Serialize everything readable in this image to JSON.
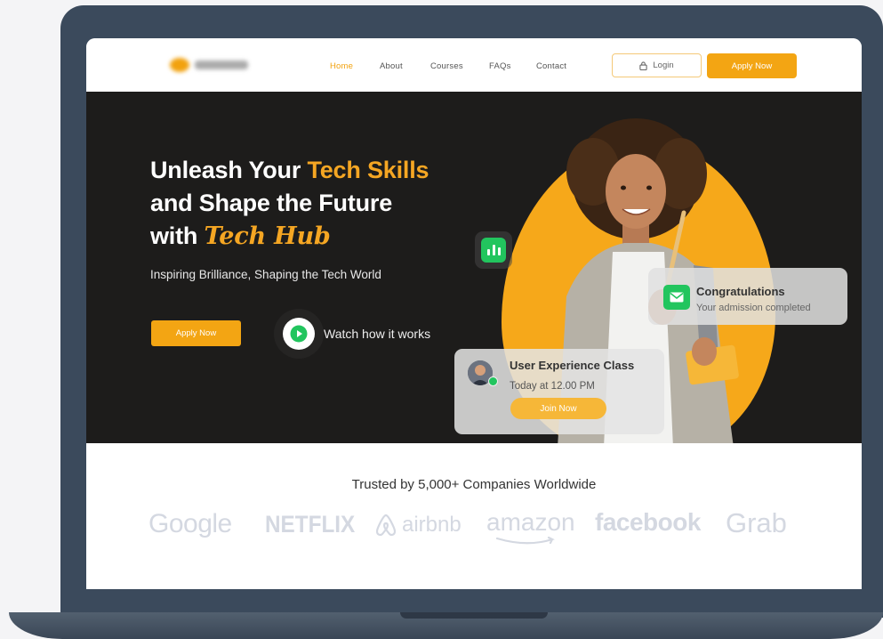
{
  "nav": {
    "links": [
      "Home",
      "About",
      "Courses",
      "FAQs",
      "Contact"
    ],
    "active": "Home",
    "login_label": "Login",
    "apply_label": "Apply Now"
  },
  "hero": {
    "title_line1_a": "Unleash Your ",
    "title_line1_b": "Tech Skills",
    "title_line2": "and Shape the Future",
    "title_line3_a": "with ",
    "title_line3_b": "Tech Hub",
    "subtitle": "Inspiring Brilliance, Shaping the Tech World",
    "apply_label": "Apply Now",
    "watch_label": "Watch how it works"
  },
  "cards": {
    "congrats_title": "Congratulations",
    "congrats_sub": "Your admission completed",
    "class_title": "User Experience Class",
    "class_time": "Today at 12.00 PM",
    "join_label": "Join Now"
  },
  "trusted": {
    "heading": "Trusted by 5,000+ Companies Worldwide",
    "companies": [
      "Google",
      "NETFLIX",
      "airbnb",
      "amazon",
      "facebook",
      "Grab"
    ]
  },
  "colors": {
    "accent": "#f3a513",
    "hero_bg": "#1d1c1b",
    "success": "#22c55e",
    "laptop_frame": "#3b4a5c"
  },
  "icons": [
    "lock-icon",
    "play-icon",
    "bar-chart-icon",
    "mail-icon",
    "airbnb-icon"
  ]
}
